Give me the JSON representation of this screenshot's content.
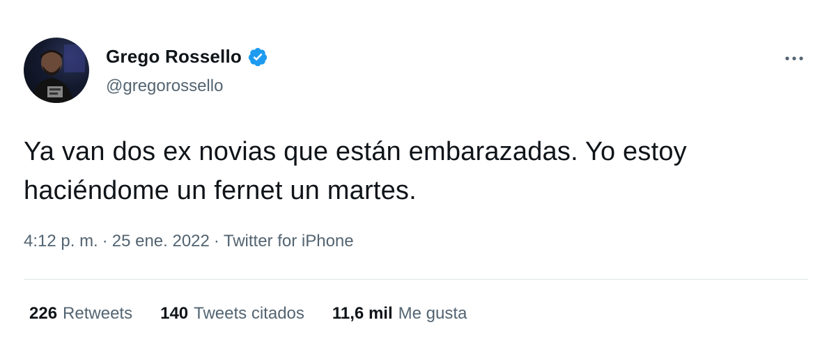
{
  "author": {
    "display_name": "Grego Rossello",
    "handle": "@gregorossello",
    "verified": true,
    "verified_badge_color": "#1d9bf0",
    "avatar_icon": "profile-photo"
  },
  "more_icon": "more-horizontal-icon",
  "tweet": {
    "text_line1": "Ya van dos ex novias que están embarazadas. Yo estoy",
    "text_line2": "haciéndome un fernet un martes."
  },
  "meta": {
    "time": "4:12 p. m.",
    "sep1": "·",
    "date": "25 ene. 2022",
    "sep2": "·",
    "source": "Twitter for iPhone"
  },
  "stats": {
    "retweets_count": "226",
    "retweets_label": "Retweets",
    "quotes_count": "140",
    "quotes_label": "Tweets citados",
    "likes_count": "11,6 mil",
    "likes_label": "Me gusta"
  },
  "colors": {
    "text_primary": "#0f1419",
    "text_secondary": "#536471",
    "divider": "#dfe3e6",
    "accent": "#1d9bf0"
  }
}
